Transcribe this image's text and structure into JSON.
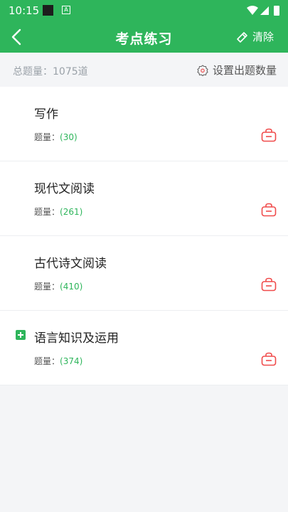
{
  "status_bar": {
    "time": "10:15",
    "icons": [
      "notification-icon",
      "a-icon",
      "wifi-icon",
      "signal-icon",
      "battery-icon"
    ]
  },
  "header": {
    "title": "考点练习",
    "clear_label": "清除"
  },
  "summary": {
    "total_text": "总题量：1075道",
    "setting_label": "设置出题数量"
  },
  "colors": {
    "brand_green": "#2eb55b",
    "lock_red": "#f04b4b"
  },
  "categories": [
    {
      "title": "写作",
      "count_label": "题量：",
      "count": "(30)"
    },
    {
      "title": "现代文阅读",
      "count_label": "题量：",
      "count": "(261)"
    },
    {
      "title": "古代诗文阅读",
      "count_label": "题量：",
      "count": "(410)"
    },
    {
      "title": "语言知识及运用",
      "count_label": "题量：",
      "count": "(374)",
      "expandable": true
    }
  ]
}
